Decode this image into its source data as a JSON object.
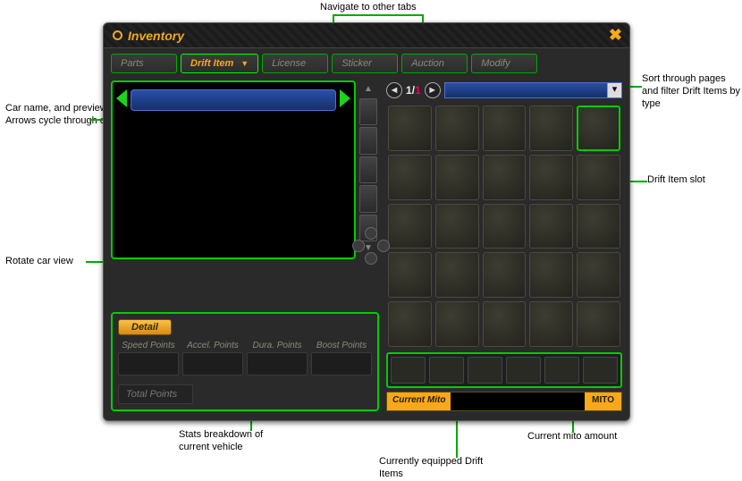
{
  "window": {
    "title": "Inventory",
    "close_glyph": "✖"
  },
  "tabs": [
    {
      "label": "Parts",
      "active": false
    },
    {
      "label": "Drift Item",
      "active": true,
      "has_dropdown": true
    },
    {
      "label": "License",
      "active": false
    },
    {
      "label": "Sticker",
      "active": false
    },
    {
      "label": "Auction",
      "active": false
    },
    {
      "label": "Modify",
      "active": false
    }
  ],
  "pager": {
    "prev_glyph": "◄",
    "next_glyph": "►",
    "current": "1",
    "sep": "/",
    "total": "1",
    "filter_dd_glyph": "▾"
  },
  "stats": {
    "detail_label": "Detail",
    "headers": [
      "Speed Points",
      "Accel. Points",
      "Dura. Points",
      "Boost Points"
    ],
    "total_label": "Total Points"
  },
  "mito": {
    "label": "Current Mito",
    "currency": "MITO"
  },
  "annotations": {
    "tabs": "Navigate to other tabs",
    "preview": "Car name, and preview. Arrows cycle through cars.",
    "rotate": "Rotate car view",
    "stats": "Stats breakdown of current vehicle",
    "equipped": "Currently equipped Drift Items",
    "mito": "Current mito amount",
    "slot": "Drift Item slot",
    "pager": "Sort through pages and filter Drift Items by type"
  }
}
